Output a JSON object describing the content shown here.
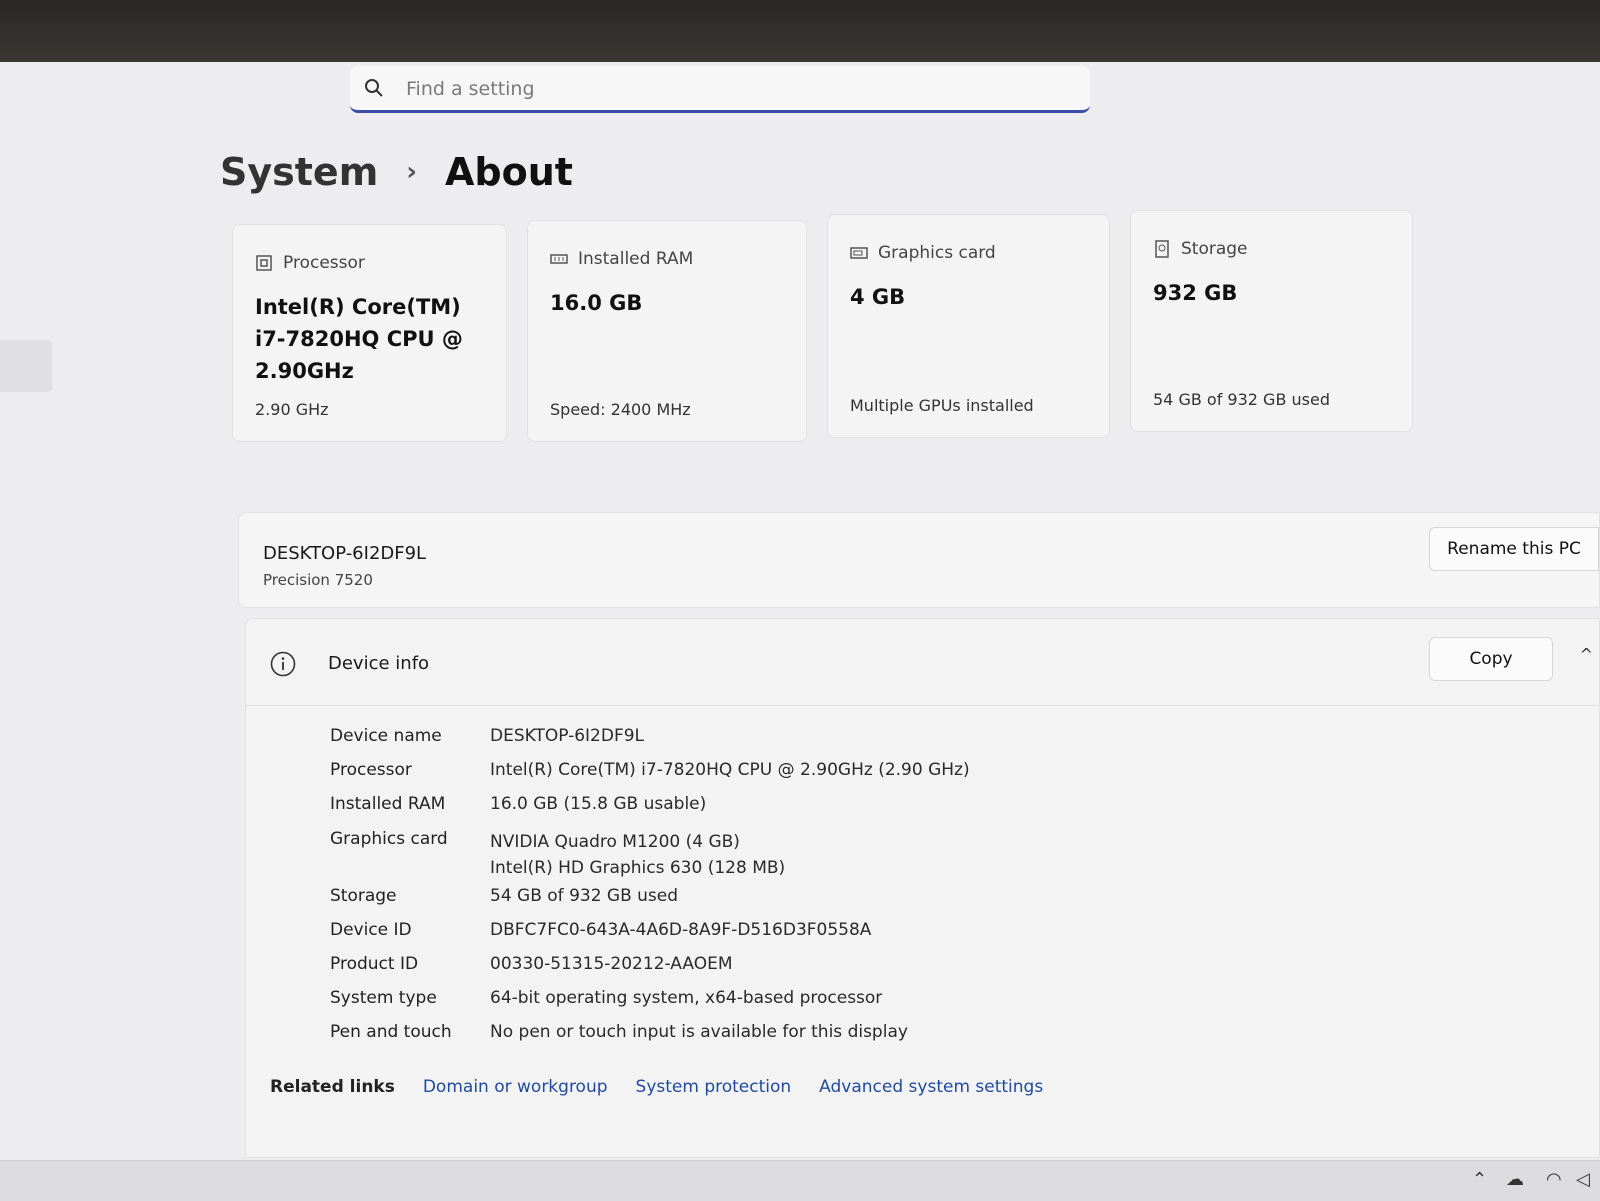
{
  "search": {
    "placeholder": "Find a setting"
  },
  "breadcrumb": {
    "parent": "System",
    "separator": "›",
    "current": "About"
  },
  "cards": [
    {
      "icon": "processor-icon",
      "label": "Processor",
      "value_lines": [
        "Intel(R) Core(TM)",
        "i7-7820HQ CPU @",
        "2.90GHz"
      ],
      "sub": "2.90 GHz"
    },
    {
      "icon": "ram-icon",
      "label": "Installed RAM",
      "value_lines": [
        "16.0 GB"
      ],
      "sub": "Speed: 2400 MHz"
    },
    {
      "icon": "graphics-card-icon",
      "label": "Graphics card",
      "value_lines": [
        "4 GB"
      ],
      "sub": "Multiple GPUs installed"
    },
    {
      "icon": "storage-icon",
      "label": "Storage",
      "value_lines": [
        "932 GB"
      ],
      "sub": "54 GB of 932 GB used"
    }
  ],
  "pc": {
    "name": "DESKTOP-6I2DF9L",
    "model": "Precision 7520",
    "rename_label": "Rename this PC"
  },
  "device_info": {
    "title": "Device info",
    "copy_label": "Copy",
    "chevron": "^",
    "rows": [
      {
        "key": "Device name",
        "value": "DESKTOP-6I2DF9L"
      },
      {
        "key": "Processor",
        "value": "Intel(R) Core(TM) i7-7820HQ CPU @ 2.90GHz (2.90 GHz)"
      },
      {
        "key": "Installed RAM",
        "value": "16.0 GB (15.8 GB usable)"
      },
      {
        "key": "Graphics card",
        "value": "NVIDIA Quadro M1200 (4 GB)",
        "value2": "Intel(R) HD Graphics 630 (128 MB)"
      },
      {
        "key": "Storage",
        "value": "54 GB of 932 GB used"
      },
      {
        "key": "Device ID",
        "value": "DBFC7FC0-643A-4A6D-8A9F-D516D3F0558A"
      },
      {
        "key": "Product ID",
        "value": "00330-51315-20212-AAOEM"
      },
      {
        "key": "System type",
        "value": "64-bit operating system, x64-based processor"
      },
      {
        "key": "Pen and touch",
        "value": "No pen or touch input is available for this display"
      }
    ]
  },
  "related_links": {
    "header": "Related links",
    "links": [
      "Domain or workgroup",
      "System protection",
      "Advanced system settings"
    ]
  }
}
